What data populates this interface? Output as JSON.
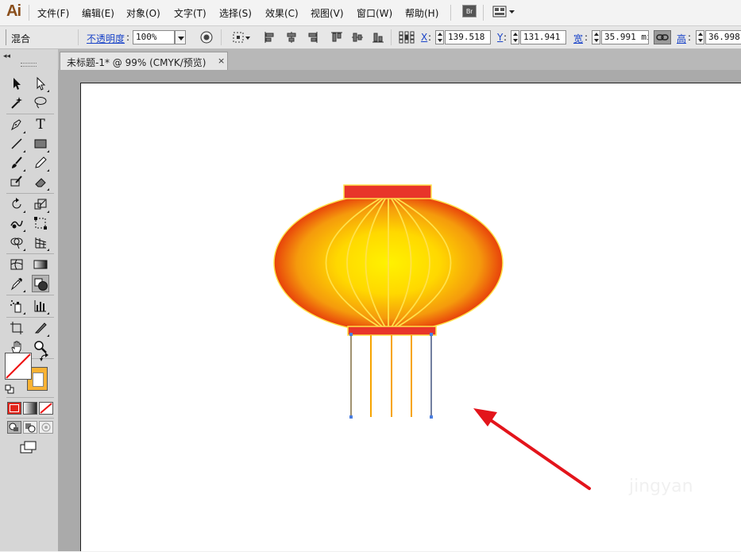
{
  "app": {
    "logo": "Ai"
  },
  "menu": {
    "items": [
      "文件(F)",
      "编辑(E)",
      "对象(O)",
      "文字(T)",
      "选择(S)",
      "效果(C)",
      "视图(V)",
      "窗口(W)",
      "帮助(H)"
    ],
    "bridge_label": "Br"
  },
  "control_bar": {
    "blend_label": "混合",
    "opacity_label": "不透明度",
    "opacity_colon": ":",
    "opacity_value": "100%",
    "x_label": "X",
    "x_value": "139.518 r",
    "y_label": "Y",
    "y_value": "131.941 r",
    "w_label": "宽",
    "w_value": "35.991 mi",
    "h_label": "高",
    "h_value": "36.998",
    "colon": ":"
  },
  "document": {
    "tab_title": "未标题-1* @ 99% (CMYK/预览)",
    "close_glyph": "×"
  },
  "panel": {
    "collapse_glyph": "◂◂"
  },
  "tools": {
    "type_tool_glyph": "T"
  },
  "colors": {
    "lantern_center": "#FFF200",
    "lantern_edge": "#E8410B",
    "cap": "#E8352A",
    "rib": "#FFE14A",
    "tassel": "#F7A400",
    "arrow": "#E3141B",
    "stroke_swatch": "#F9B233"
  },
  "artwork": {
    "watermark_text": "jingyan"
  }
}
